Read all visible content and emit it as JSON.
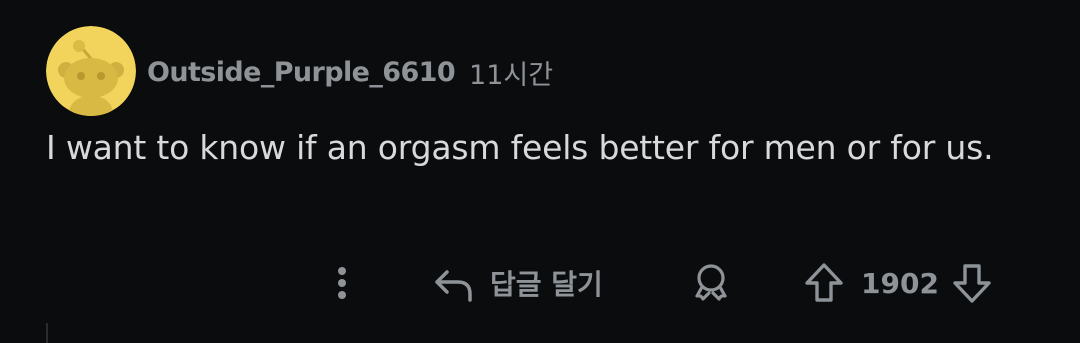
{
  "comment": {
    "username": "Outside_Purple_6610",
    "timestamp": "11시간",
    "body": "I want to know if an orgasm feels better for men or for us.",
    "avatar_icon": "snoo-avatar-icon"
  },
  "actions": {
    "more_icon": "more-vertical-icon",
    "reply_icon": "reply-arrow-icon",
    "reply_label": "답글 달기",
    "award_icon": "award-icon",
    "upvote_icon": "upvote-arrow-icon",
    "vote_count": "1902",
    "downvote_icon": "downvote-arrow-icon"
  },
  "colors": {
    "background": "#0b0c0e",
    "body_text": "#d7dadc",
    "meta_text": "#8e9398",
    "avatar_bg": "#f4d35e"
  }
}
